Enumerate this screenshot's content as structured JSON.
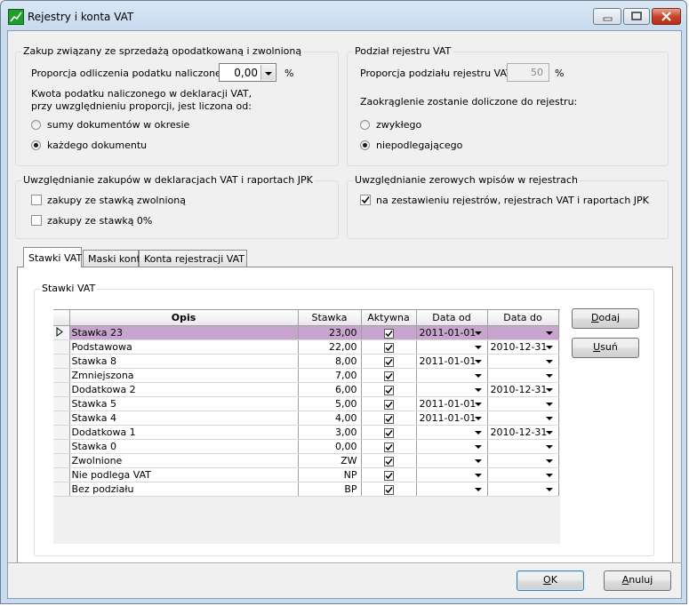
{
  "window": {
    "title": "Rejestry i konta VAT",
    "minimize_glyph": "–",
    "maximize_glyph": "□",
    "close_glyph": "✕"
  },
  "zakup": {
    "legend": "Zakup związany ze sprzedażą opodatkowaną i zwolnioną",
    "proporcja_label": "Proporcja odliczenia podatku naliczonego:",
    "proporcja_value": "0,00",
    "percent": "%",
    "kwota_line1": "Kwota podatku naliczonego w deklaracji VAT,",
    "kwota_line2": "przy uwzględnieniu proporcji, jest liczona od:",
    "radio_sumy": "sumy dokumentów w okresie",
    "radio_kazdego": "każdego dokumentu",
    "selected": "kazdego"
  },
  "podzial": {
    "legend": "Podział rejestru VAT",
    "label": "Proporcja podziału rejestru VAT:",
    "value": "50",
    "percent": "%",
    "zaokraglenie": "Zaokrąglenie zostanie doliczone do rejestru:",
    "radio_zwyklego": "zwykłego",
    "radio_niepodlegajacego": "niepodlegającego",
    "selected": "niepodlegajacego"
  },
  "uwzglednianie_zakupow": {
    "legend": "Uwzględnianie zakupów w deklaracjach VAT i raportach JPK",
    "zwolniona": "zakupy ze stawką zwolnioną",
    "zero": "zakupy ze stawką 0%",
    "zwolniona_checked": false,
    "zero_checked": false
  },
  "uwzglednianie_zerowych": {
    "legend": "Uwzględnianie zerowych wpisów w rejestrach",
    "label": "na zestawieniu rejestrów, rejestrach VAT i raportach JPK",
    "checked": true
  },
  "tabs": [
    {
      "label": "Stawki VAT",
      "active": true
    },
    {
      "label": "Maski kont",
      "active": false
    },
    {
      "label": "Konta rejestracji VAT",
      "active": false
    }
  ],
  "stawki_group": {
    "legend": "Stawki VAT"
  },
  "grid": {
    "columns": [
      "Opis",
      "Stawka",
      "Aktywna",
      "Data od",
      "Data do"
    ],
    "rows": [
      {
        "opis": "Stawka 23",
        "stawka": "23,00",
        "aktywna": true,
        "od": "2011-01-01",
        "do": "",
        "selected": true
      },
      {
        "opis": "Podstawowa",
        "stawka": "22,00",
        "aktywna": true,
        "od": "",
        "do": "2010-12-31"
      },
      {
        "opis": "Stawka 8",
        "stawka": "8,00",
        "aktywna": true,
        "od": "2011-01-01",
        "do": ""
      },
      {
        "opis": "Zmniejszona",
        "stawka": "7,00",
        "aktywna": true,
        "od": "",
        "do": ""
      },
      {
        "opis": "Dodatkowa 2",
        "stawka": "6,00",
        "aktywna": true,
        "od": "",
        "do": "2010-12-31"
      },
      {
        "opis": "Stawka 5",
        "stawka": "5,00",
        "aktywna": true,
        "od": "2011-01-01",
        "do": ""
      },
      {
        "opis": "Stawka 4",
        "stawka": "4,00",
        "aktywna": true,
        "od": "2011-01-01",
        "do": ""
      },
      {
        "opis": "Dodatkowa 1",
        "stawka": "3,00",
        "aktywna": true,
        "od": "",
        "do": "2010-12-31"
      },
      {
        "opis": "Stawka 0",
        "stawka": "0,00",
        "aktywna": true,
        "od": "",
        "do": ""
      },
      {
        "opis": "Zwolnione",
        "stawka": "ZW",
        "aktywna": true,
        "od": "",
        "do": ""
      },
      {
        "opis": "Nie podlega VAT",
        "stawka": "NP",
        "aktywna": true,
        "od": "",
        "do": ""
      },
      {
        "opis": "Bez podziału",
        "stawka": "BP",
        "aktywna": true,
        "od": "",
        "do": ""
      }
    ]
  },
  "buttons": {
    "dodaj_key": "D",
    "dodaj_rest": "odaj",
    "usun_key": "U",
    "usun_rest": "suń",
    "ok_key": "O",
    "ok_rest": "K",
    "anuluj_key": "A",
    "anuluj_rest": "nuluj"
  }
}
